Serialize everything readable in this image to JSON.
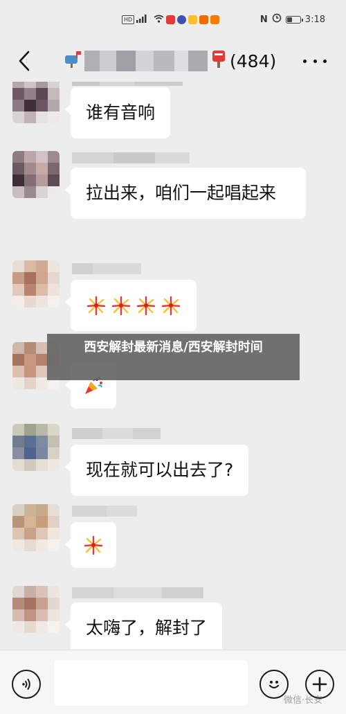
{
  "status_bar": {
    "left_badge": "HD",
    "right_badges": "N",
    "time": "3:18",
    "battery_level": 0.35
  },
  "header": {
    "member_count": "(484)",
    "back_icon": "chevron-left-icon",
    "more_icon": "more-dots-icon"
  },
  "messages": [
    {
      "text": "谁有音响",
      "type": "text"
    },
    {
      "text": "拉出来，咱们一起唱起来",
      "type": "text"
    },
    {
      "type": "emoji",
      "emojis": [
        "fireworks",
        "fireworks",
        "fireworks",
        "fireworks"
      ]
    },
    {
      "type": "emoji",
      "emojis": [
        "party-popper"
      ]
    },
    {
      "text": "现在就可以出去了?",
      "type": "text"
    },
    {
      "type": "emoji",
      "emojis": [
        "fireworks"
      ]
    },
    {
      "text": "太嗨了，解封了",
      "type": "text"
    }
  ],
  "banner": {
    "text": "西安解封最新消息/西安解封时间"
  },
  "input_bar": {
    "placeholder": "",
    "voice_icon": "voice-icon",
    "emoji_icon": "emoji-icon",
    "plus_icon": "plus-icon"
  },
  "watermark": "微信·长安"
}
